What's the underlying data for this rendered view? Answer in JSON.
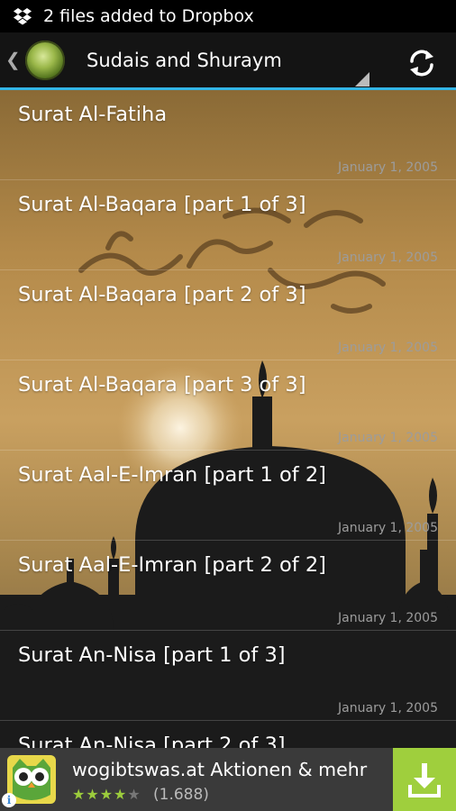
{
  "status_bar": {
    "notification_icon": "dropbox-icon",
    "text": "2 files added to Dropbox"
  },
  "action_bar": {
    "title": "Sudais and Shuraym",
    "logo_icon": "quran-logo-icon",
    "refresh_icon": "refresh-icon",
    "accent": "#33b5e5"
  },
  "list": [
    {
      "title": "Surat Al-Fatiha",
      "date": "January 1, 2005"
    },
    {
      "title": "Surat Al-Baqara [part 1 of 3]",
      "date": "January 1, 2005"
    },
    {
      "title": "Surat Al-Baqara [part 2 of 3]",
      "date": "January 1, 2005"
    },
    {
      "title": "Surat Al-Baqara [part 3 of 3]",
      "date": "January 1, 2005"
    },
    {
      "title": "Surat Aal-E-Imran [part 1 of 2]",
      "date": "January 1, 2005"
    },
    {
      "title": "Surat Aal-E-Imran [part 2 of 2]",
      "date": "January 1, 2005"
    },
    {
      "title": "Surat An-Nisa [part 1 of 3]",
      "date": "January 1, 2005"
    },
    {
      "title": "Surat An-Nisa [part 2 of 3]",
      "date": ""
    }
  ],
  "ad": {
    "title": "wogibtswas.at Aktionen & mehr",
    "rating": 4,
    "rating_max": 5,
    "review_count": "(1.688)",
    "accent": "#9fcf3d"
  }
}
